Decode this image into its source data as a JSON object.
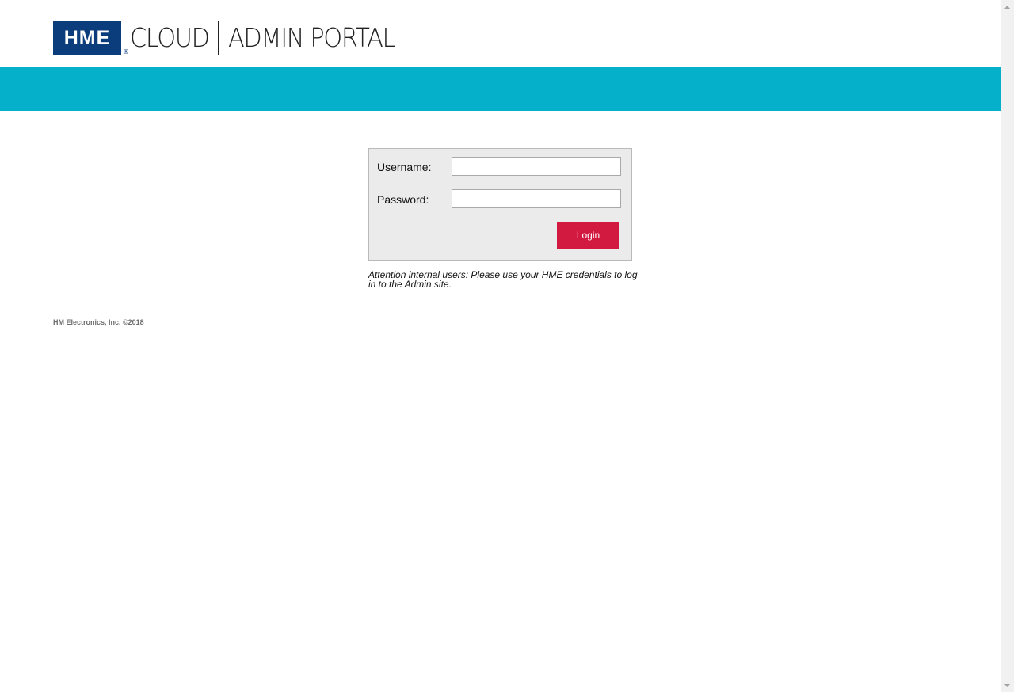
{
  "header": {
    "logo_hme": "HME",
    "logo_reg": "®",
    "logo_cloud": "CLOUD",
    "logo_portal": "ADMIN PORTAL"
  },
  "colors": {
    "brand_blue": "#0b3d7c",
    "teal_bar": "#05b0ca",
    "login_button": "#d21940",
    "login_panel": "#ebebeb"
  },
  "login": {
    "username_label": "Username:",
    "username_value": "",
    "password_label": "Password:",
    "password_value": "",
    "button_label": "Login"
  },
  "notice": {
    "text": "Attention internal users: Please use your HME credentials to log in to the Admin site."
  },
  "footer": {
    "copyright": "HM Electronics, Inc. ©2018"
  },
  "icons": {
    "scroll_up": "scroll-up-arrow-icon",
    "scroll_down": "scroll-down-arrow-icon"
  }
}
